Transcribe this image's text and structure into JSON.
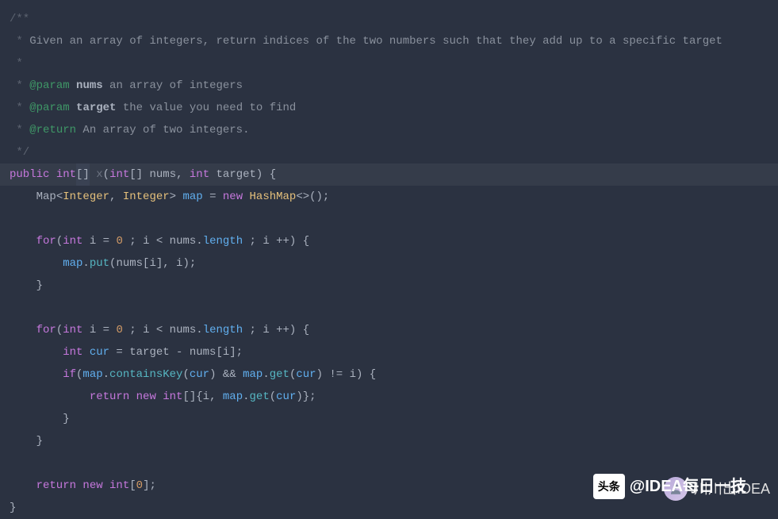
{
  "code": {
    "l1": "/**",
    "l2_pre": " * ",
    "l2_desc": "Given an array of integers, return indices of the two numbers such that they add up to a specific target",
    "l3": " *",
    "l4_pre": " * ",
    "l4_tag": "@param",
    "l4_name": "nums",
    "l4_desc": " an array of integers",
    "l5_pre": " * ",
    "l5_tag": "@param",
    "l5_name": "target",
    "l5_desc": " the value you need to find",
    "l6_pre": " * ",
    "l6_tag": "@return",
    "l6_desc": " An array of two integers.",
    "l7": " */",
    "l8_public": "public ",
    "l8_int": "int",
    "l8_br": "[]",
    "l8_x": " x",
    "l8_open": "(",
    "l8_int2": "int",
    "l8_arr": "[] nums, ",
    "l8_int3": "int",
    "l8_tgt": " target) {",
    "l9_map": "    Map",
    "l9_lt": "<",
    "l9_integer1": "Integer",
    "l9_comma": ", ",
    "l9_integer2": "Integer",
    "l9_gt": "> ",
    "l9_mapvar": "map",
    "l9_eq": " = ",
    "l9_new": "new ",
    "l9_hashmap": "HashMap",
    "l9_end": "<>();",
    "l11_for": "    for",
    "l11_open": "(",
    "l11_int": "int",
    "l11_i": " i = ",
    "l11_zero": "0",
    "l11_cond1": " ; i < nums.",
    "l11_length": "length",
    "l11_cond2": " ; i ++) {",
    "l12_map": "        map",
    "l12_dot": ".",
    "l12_put": "put",
    "l12_args": "(nums[i], i);",
    "l13_close": "    }",
    "l15_for": "    for",
    "l15_open": "(",
    "l15_int": "int",
    "l15_i": " i = ",
    "l15_zero": "0",
    "l15_cond1": " ; i < nums.",
    "l15_length": "length",
    "l15_cond2": " ; i ++) {",
    "l16_int": "        int",
    "l16_cur": " cur",
    "l16_eq": " = target - nums[i];",
    "l17_if": "        if",
    "l17_open": "(",
    "l17_map1": "map",
    "l17_dot1": ".",
    "l17_ck": "containsKey",
    "l17_p1": "(",
    "l17_cur1": "cur",
    "l17_p2": ") && ",
    "l17_map2": "map",
    "l17_dot2": ".",
    "l17_get": "get",
    "l17_p3": "(",
    "l17_cur2": "cur",
    "l17_p4": ") != i) {",
    "l18_ret": "            return ",
    "l18_new": "new ",
    "l18_int": "int",
    "l18_br": "[]{i, ",
    "l18_map": "map",
    "l18_dot": ".",
    "l18_get": "get",
    "l18_p1": "(",
    "l18_cur": "cur",
    "l18_p2": ")};",
    "l19_close": "        }",
    "l20_close": "    }",
    "l22_ret": "    return ",
    "l22_new": "new ",
    "l22_int": "int",
    "l22_br1": "[",
    "l22_zero": "0",
    "l22_br2": "];",
    "l23_close": "}"
  },
  "watermark": {
    "label1": "头条",
    "label2": "@IDEA每日一技",
    "avatar_text": "...",
    "mini_text": "川川出IDEA"
  }
}
